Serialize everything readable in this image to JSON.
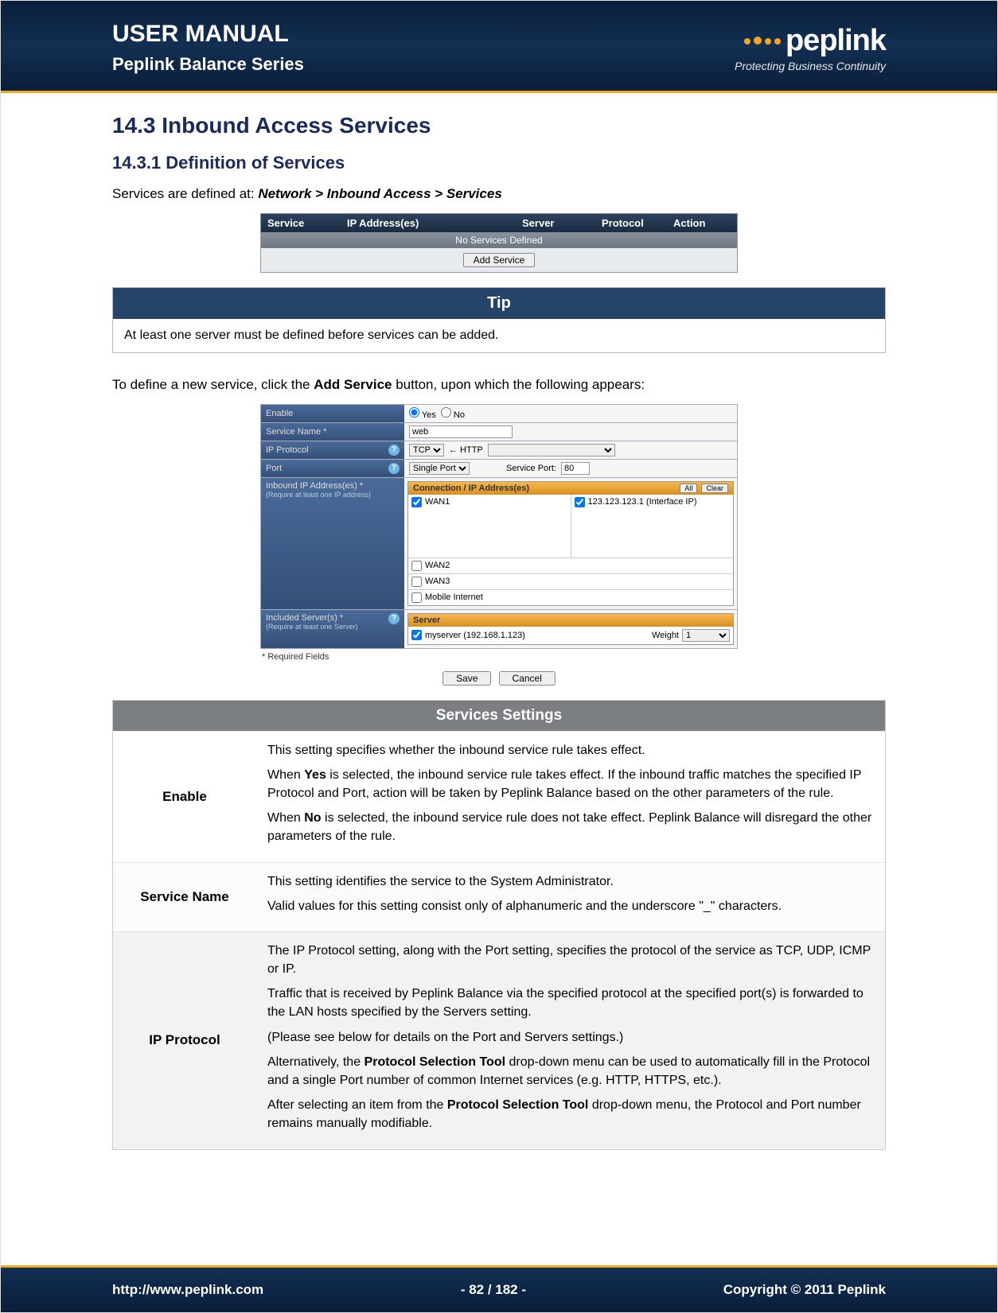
{
  "header": {
    "title": "USER MANUAL",
    "subtitle": "Peplink Balance Series",
    "brand": "peplink",
    "tagline": "Protecting Business Continuity"
  },
  "section": {
    "num_title": "14.3   Inbound Access Services",
    "sub_num_title": "14.3.1 Definition of Services",
    "intro_prefix": "Services are defined at: ",
    "breadcrumb": "Network > Inbound Access > Services"
  },
  "svc_table": {
    "cols": {
      "service": "Service",
      "ip": "IP Address(es)",
      "server": "Server",
      "protocol": "Protocol",
      "action": "Action"
    },
    "empty": "No Services Defined",
    "add_btn": "Add Service"
  },
  "tip": {
    "title": "Tip",
    "body": "At least one server must be defined before services can be added."
  },
  "para2_pre": "To define a new service, click the ",
  "para2_bold": "Add Service",
  "para2_post": " button, upon which the following appears:",
  "form": {
    "labels": {
      "enable": "Enable",
      "service_name": "Service Name *",
      "ip_protocol": "IP Protocol",
      "port": "Port",
      "inbound_ip": "Inbound IP Address(es) *",
      "inbound_ip_note": "(Require at least one IP address)",
      "included_servers": "Included Server(s) *",
      "included_servers_note": "(Require at least one Server)"
    },
    "enable_yes": "Yes",
    "enable_no": "No",
    "service_name_val": "web",
    "proto_val": "TCP",
    "proto_tool_label": "← HTTP",
    "port_mode": "Single Port",
    "port_label": "Service Port:",
    "port_val": "80",
    "conn_header": "Connection / IP Address(es)",
    "btn_all": "All",
    "btn_clear": "Clear",
    "wan1": "WAN1",
    "wan1_ip": "123.123.123.1 (Interface IP)",
    "wan2": "WAN2",
    "wan3": "WAN3",
    "mobile": "Mobile Internet",
    "server_header": "Server",
    "server1": "myserver (192.168.1.123)",
    "weight_label": "Weight",
    "weight_val": "1",
    "req": "* Required Fields",
    "save": "Save",
    "cancel": "Cancel"
  },
  "settings": {
    "title": "Services Settings",
    "rows": [
      {
        "key": "Enable",
        "paras": [
          "This setting specifies whether the inbound service rule takes effect.",
          "When <b>Yes</b> is selected, the inbound service rule takes effect.  If the inbound traffic matches the specified IP Protocol and Port, action will be taken by Peplink Balance based on the other parameters of the rule.",
          "When <b>No</b> is selected, the inbound service rule does not take effect.  Peplink Balance will disregard the other parameters of the rule."
        ]
      },
      {
        "key": "Service Name",
        "paras": [
          "This setting identifies the service to the System Administrator.",
          "Valid values for this setting consist only of alphanumeric and the underscore \"_\" characters."
        ]
      },
      {
        "key": "IP Protocol",
        "paras": [
          "The IP Protocol setting, along with the Port setting, specifies the protocol of the service as TCP, UDP, ICMP or IP.",
          "Traffic that is received by Peplink Balance via the specified protocol at the specified port(s) is forwarded to the LAN hosts specified by the Servers setting.",
          "(Please see below for details on the Port and Servers settings.)",
          "Alternatively, the <b>Protocol Selection Tool</b> drop-down menu can be used to automatically fill in the Protocol and a single Port number of common Internet services (e.g. HTTP, HTTPS, etc.).",
          "After selecting an item from the <b>Protocol Selection Tool</b> drop-down menu, the Protocol and Port number remains manually modifiable."
        ]
      }
    ]
  },
  "footer": {
    "url": "http://www.peplink.com",
    "page": "- 82 / 182 -",
    "copyright": "Copyright © 2011 Peplink"
  }
}
